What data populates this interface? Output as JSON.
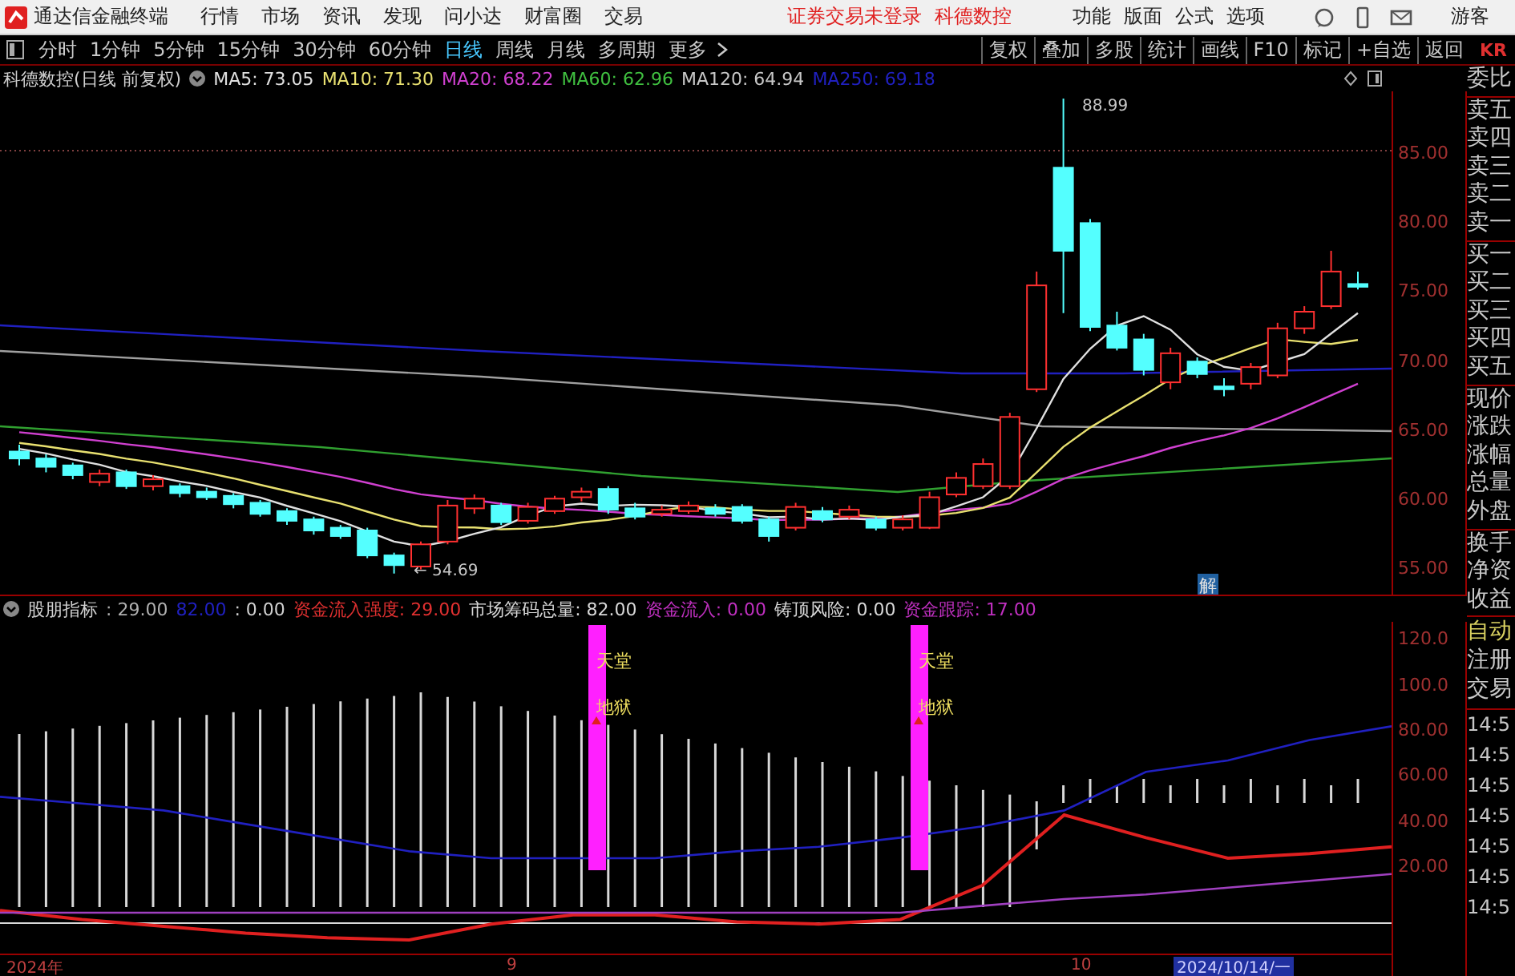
{
  "app": {
    "title": "通达信金融终端"
  },
  "menu": [
    "行情",
    "市场",
    "资讯",
    "发现",
    "问小达",
    "财富圈",
    "交易"
  ],
  "notices": [
    "证券交易未登录",
    "科德数控"
  ],
  "menu_right": [
    "功能",
    "版面",
    "公式",
    "选项"
  ],
  "user": "游客",
  "periods": [
    {
      "label": "分时",
      "selected": false
    },
    {
      "label": "1分钟",
      "selected": false
    },
    {
      "label": "5分钟",
      "selected": false
    },
    {
      "label": "15分钟",
      "selected": false
    },
    {
      "label": "30分钟",
      "selected": false
    },
    {
      "label": "60分钟",
      "selected": false
    },
    {
      "label": "日线",
      "selected": true
    },
    {
      "label": "周线",
      "selected": false
    },
    {
      "label": "月线",
      "selected": false
    },
    {
      "label": "多周期",
      "selected": false
    },
    {
      "label": "更多",
      "selected": false
    }
  ],
  "tools": [
    "复权",
    "叠加",
    "多股",
    "统计",
    "画线",
    "F10",
    "标记",
    "+自选",
    "返回"
  ],
  "side_tab": "KR",
  "main_chart": {
    "title": "科德数控(日线 前复权)",
    "legend": [
      {
        "label": "MA5: 73.05",
        "color": "#e0e0e0"
      },
      {
        "label": "MA10: 71.30",
        "color": "#e8e070"
      },
      {
        "label": "MA20: 68.22",
        "color": "#d040d0"
      },
      {
        "label": "MA60: 62.96",
        "color": "#40c040"
      },
      {
        "label": "MA120: 64.94",
        "color": "#c8c8c8"
      },
      {
        "label": "MA250: 69.18",
        "color": "#2020c0"
      }
    ],
    "y_labels": [
      "85.00",
      "80.00",
      "75.00",
      "70.00",
      "65.00",
      "60.00",
      "55.00"
    ],
    "high_label": "88.99",
    "low_label": "← 54.69",
    "mark": "解"
  },
  "indicator": {
    "name": "股朋指标",
    "legend": [
      {
        "label": ": 29.00",
        "color": "#b0b0b0"
      },
      {
        "label": "82.00",
        "color": "#2020c0"
      },
      {
        "label": ": 0.00",
        "color": "#d0d0d0"
      },
      {
        "label": "资金流入强度: 29.00",
        "color": "#e03030"
      },
      {
        "label": "市场筹码总量: 82.00",
        "color": "#d8d8d8"
      },
      {
        "label": "资金流入: 0.00",
        "color": "#c030c0"
      },
      {
        "label": "铸顶风险: 0.00",
        "color": "#d8d8d8"
      },
      {
        "label": "资金跟踪: 17.00",
        "color": "#c030c0"
      }
    ],
    "signals": [
      {
        "top": "天堂",
        "bottom": "地狱"
      },
      {
        "top": "天堂",
        "bottom": "地狱"
      }
    ],
    "chart_data": {
      "type": "line",
      "ylim": [
        -18,
        128
      ],
      "yticks": [
        {
          "value": 120,
          "label": "120.0"
        },
        {
          "value": 100,
          "label": "100.0"
        },
        {
          "value": 80,
          "label": "80.00"
        },
        {
          "value": 60,
          "label": "60.00"
        },
        {
          "value": 40,
          "label": "40.00"
        },
        {
          "value": 20,
          "label": "20.00"
        }
      ],
      "series": [
        {
          "color": "#2020c0",
          "values": [
            51,
            48,
            45,
            39,
            33,
            27,
            24,
            24,
            24,
            27,
            29,
            33,
            38,
            45,
            62,
            67,
            76,
            82
          ]
        },
        {
          "color": "#e02020",
          "values": [
            1,
            -3,
            -6,
            -9,
            -11,
            -12,
            -5,
            -1,
            -1,
            -4,
            -5,
            -3,
            12,
            43,
            33,
            24,
            26,
            29
          ]
        },
        {
          "color": "#a040c0",
          "values": [
            0,
            0,
            0,
            0,
            0,
            0,
            0,
            0,
            0,
            0,
            0,
            0,
            3,
            6,
            8,
            11,
            14,
            17
          ]
        }
      ]
    }
  },
  "x_axis": [
    {
      "label": "2024年",
      "selected": false
    },
    {
      "label": "9",
      "selected": false
    },
    {
      "label": "10",
      "selected": false
    },
    {
      "label": "2024/10/14/一",
      "selected": true
    }
  ],
  "side_panel": {
    "groups": [
      [
        "委比"
      ],
      [
        "卖五",
        "卖四",
        "卖三",
        "卖二",
        "卖一"
      ],
      [
        "买一",
        "买二",
        "买三",
        "买四",
        "买五"
      ],
      [
        "现价",
        "涨跌",
        "涨幅",
        "总量",
        "外盘"
      ],
      [
        "换手",
        "净资",
        "收益"
      ]
    ],
    "actions": [
      {
        "label": "自动",
        "color": "#d8d060"
      },
      {
        "label": "注册",
        "color": "#c8c8c8"
      },
      {
        "label": "交易",
        "color": "#c8c8c8"
      }
    ],
    "times": [
      "14:5",
      "14:5",
      "14:5",
      "14:5",
      "14:5",
      "14:5",
      "14:5"
    ]
  }
}
